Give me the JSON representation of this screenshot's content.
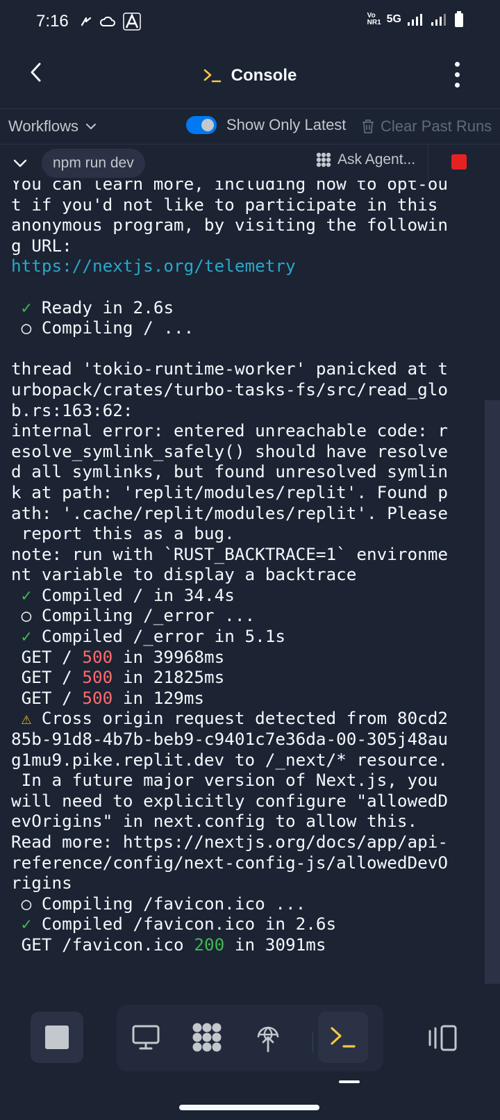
{
  "status_bar": {
    "time": "7:16",
    "network_label": "5G",
    "volte_label": "Vo NR1"
  },
  "header": {
    "title": "Console",
    "title_icon": "terminal-prompt-icon"
  },
  "workflows_bar": {
    "workflows_label": "Workflows",
    "toggle_label": "Show Only Latest",
    "toggle_on": true,
    "clear_label": "Clear Past Runs"
  },
  "process_bar": {
    "command": "npm run dev",
    "ask_agent_label": "Ask Agent..."
  },
  "console": {
    "lines": [
      {
        "segments": [
          {
            "text": "You can learn more, including how to opt-ou"
          }
        ]
      },
      {
        "segments": [
          {
            "text": "t if you'd not like to participate in this"
          }
        ]
      },
      {
        "segments": [
          {
            "text": "anonymous program, by visiting the followin"
          }
        ]
      },
      {
        "segments": [
          {
            "text": "g URL:"
          }
        ]
      },
      {
        "segments": [
          {
            "text": "https://nextjs.org/telemetry",
            "style": "link"
          }
        ]
      },
      {
        "segments": [
          {
            "text": ""
          }
        ]
      },
      {
        "segments": [
          {
            "text": " "
          },
          {
            "text": "✓",
            "style": "green"
          },
          {
            "text": " Ready in 2.6s"
          }
        ]
      },
      {
        "segments": [
          {
            "text": " ○ Compiling / ..."
          }
        ]
      },
      {
        "segments": [
          {
            "text": ""
          }
        ]
      },
      {
        "segments": [
          {
            "text": "thread 'tokio-runtime-worker' panicked at t"
          }
        ]
      },
      {
        "segments": [
          {
            "text": "urbopack/crates/turbo-tasks-fs/src/read_glo"
          }
        ]
      },
      {
        "segments": [
          {
            "text": "b.rs:163:62:"
          }
        ]
      },
      {
        "segments": [
          {
            "text": "internal error: entered unreachable code: r"
          }
        ]
      },
      {
        "segments": [
          {
            "text": "esolve_symlink_safely() should have resolve"
          }
        ]
      },
      {
        "segments": [
          {
            "text": "d all symlinks, but found unresolved symlin"
          }
        ]
      },
      {
        "segments": [
          {
            "text": "k at path: 'replit/modules/replit'. Found p"
          }
        ]
      },
      {
        "segments": [
          {
            "text": "ath: '.cache/replit/modules/replit'. Please"
          }
        ]
      },
      {
        "segments": [
          {
            "text": " report this as a bug."
          }
        ]
      },
      {
        "segments": [
          {
            "text": "note: run with `RUST_BACKTRACE=1` environme"
          }
        ]
      },
      {
        "segments": [
          {
            "text": "nt variable to display a backtrace"
          }
        ]
      },
      {
        "segments": [
          {
            "text": " "
          },
          {
            "text": "✓",
            "style": "green"
          },
          {
            "text": " Compiled / in 34.4s"
          }
        ]
      },
      {
        "segments": [
          {
            "text": " ○ Compiling /_error ..."
          }
        ]
      },
      {
        "segments": [
          {
            "text": " "
          },
          {
            "text": "✓",
            "style": "green"
          },
          {
            "text": " Compiled /_error in 5.1s"
          }
        ]
      },
      {
        "segments": [
          {
            "text": " GET / "
          },
          {
            "text": "500",
            "style": "red"
          },
          {
            "text": " in 39968ms"
          }
        ]
      },
      {
        "segments": [
          {
            "text": " GET / "
          },
          {
            "text": "500",
            "style": "red"
          },
          {
            "text": " in 21825ms"
          }
        ]
      },
      {
        "segments": [
          {
            "text": " GET / "
          },
          {
            "text": "500",
            "style": "red"
          },
          {
            "text": " in 129ms"
          }
        ]
      },
      {
        "segments": [
          {
            "text": " "
          },
          {
            "text": "⚠",
            "style": "yellow"
          },
          {
            "text": " Cross origin request detected from 80cd2"
          }
        ]
      },
      {
        "segments": [
          {
            "text": "85b-91d8-4b7b-beb9-c9401c7e36da-00-305j48au"
          }
        ]
      },
      {
        "segments": [
          {
            "text": "g1mu9.pike.replit.dev to /_next/* resource."
          }
        ]
      },
      {
        "segments": [
          {
            "text": " In a future major version of Next.js, you"
          }
        ]
      },
      {
        "segments": [
          {
            "text": "will need to explicitly configure \"allowedD"
          }
        ]
      },
      {
        "segments": [
          {
            "text": "evOrigins\" in next.config to allow this."
          }
        ]
      },
      {
        "segments": [
          {
            "text": "Read more: https://nextjs.org/docs/app/api-"
          }
        ]
      },
      {
        "segments": [
          {
            "text": "reference/config/next-config-js/allowedDevO"
          }
        ]
      },
      {
        "segments": [
          {
            "text": "rigins"
          }
        ]
      },
      {
        "segments": [
          {
            "text": " ○ Compiling /favicon.ico ..."
          }
        ]
      },
      {
        "segments": [
          {
            "text": " "
          },
          {
            "text": "✓",
            "style": "green"
          },
          {
            "text": " Compiled /favicon.ico in 2.6s"
          }
        ]
      },
      {
        "segments": [
          {
            "text": " GET /favicon.ico "
          },
          {
            "text": "200",
            "style": "green"
          },
          {
            "text": " in 3091ms"
          }
        ]
      }
    ]
  },
  "bottom_nav": {
    "tools": [
      "monitor-icon",
      "agent-icon",
      "deploy-icon",
      "console-icon"
    ],
    "active_tool": "console-icon"
  },
  "colors": {
    "background": "#1c2333",
    "accent_blue": "#0079f2",
    "stop_red": "#e52222",
    "link": "#2aa8c9",
    "success_green": "#3fb950",
    "error_red": "#ff6c6c",
    "warning_yellow": "#e5b82e",
    "console_yellow": "#f5c842"
  }
}
